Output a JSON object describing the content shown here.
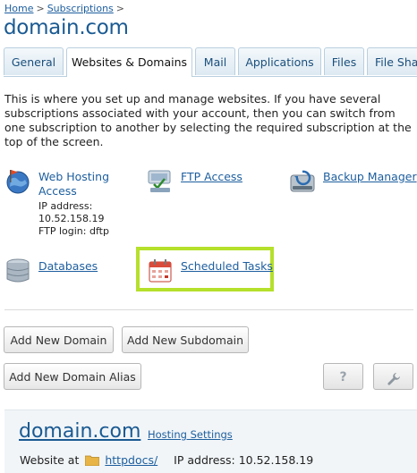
{
  "breadcrumb": {
    "home": "Home",
    "separator": ">",
    "subscriptions": "Subscriptions"
  },
  "page_title": "domain.com",
  "tabs": [
    {
      "label": "General"
    },
    {
      "label": "Websites & Domains",
      "active": true
    },
    {
      "label": "Mail"
    },
    {
      "label": "Applications"
    },
    {
      "label": "Files"
    },
    {
      "label": "File Shar"
    }
  ],
  "intro_text": "This is where you set up and manage websites. If you have several subscriptions associated with your account, then you can switch from one subscription to another by selecting the required subscription at the top of the screen.",
  "tools": {
    "web_hosting": {
      "label": "Web Hosting Access",
      "ip_line": "IP address:",
      "ip_value": "10.52.158.19",
      "ftp_login": "FTP login: dftp",
      "icon": "globe-flag-icon"
    },
    "ftp": {
      "label": "FTP Access",
      "icon": "ftp-folder-icon"
    },
    "backup": {
      "label": "Backup Manager",
      "icon": "backup-drive-icon"
    },
    "databases": {
      "label": "Databases",
      "icon": "database-icon"
    },
    "scheduled": {
      "label": "Scheduled Tasks",
      "icon": "calendar-icon"
    }
  },
  "buttons": {
    "add_domain": "Add New Domain",
    "add_subdomain": "Add New Subdomain",
    "add_alias": "Add New Domain Alias",
    "help": "?",
    "tools_icon": "wrench-icon"
  },
  "domain_panel": {
    "name": "domain.com",
    "hosting_settings": "Hosting Settings",
    "website_at": "Website at",
    "docroot": "httpdocs/",
    "ip_label": "IP address:",
    "ip_value": "10.52.158.19"
  },
  "colors": {
    "link": "#1d5e9e",
    "title": "#1a5a92",
    "highlight": "#b5e02b"
  }
}
